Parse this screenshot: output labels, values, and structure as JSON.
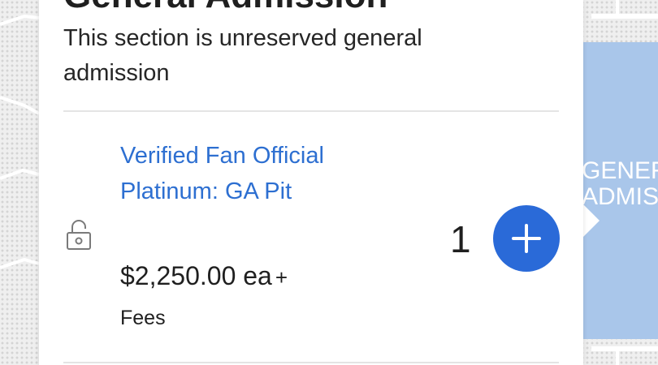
{
  "map": {
    "section_label_line1": "GENERAL",
    "section_label_line2": "ADMISSION",
    "colors": {
      "ga_block": "#a9c6ea",
      "seat_dots": "#d4d4d4"
    }
  },
  "panel": {
    "title": "General Admission",
    "description": "This section is unreserved general admission",
    "ticket": {
      "name": "Verified Fan Official Platinum: GA Pit",
      "price": "$2,250.00 ea",
      "price_plus": "+",
      "fees_label": "Fees",
      "quantity": "1",
      "lock_icon": "unlocked-padlock-icon",
      "add_icon": "plus-icon"
    },
    "colors": {
      "link": "#2d6fd1",
      "button": "#2a6ad8"
    }
  }
}
